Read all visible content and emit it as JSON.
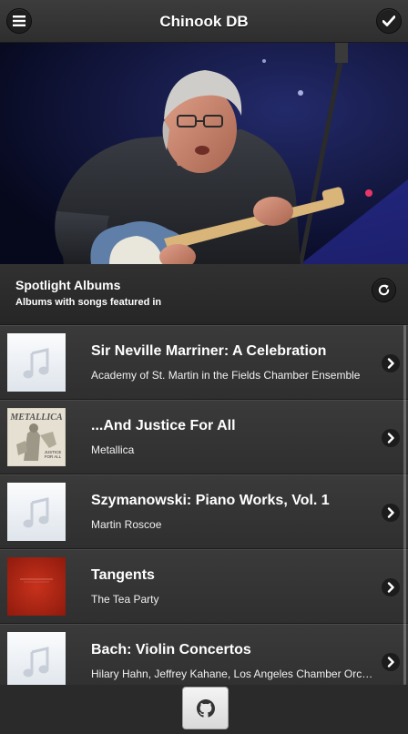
{
  "header": {
    "title": "Chinook DB",
    "menu_icon": "menu-icon",
    "check_icon": "check-icon"
  },
  "hero": {
    "description_icon": "guitarist-photo"
  },
  "spotlight": {
    "title": "Spotlight Albums",
    "subtitle": "Albums with songs featured in",
    "refresh_icon": "refresh-icon"
  },
  "albums": [
    {
      "title": "Sir Neville Marriner: A Celebration",
      "artist": "Academy of St. Martin in the Fields Chamber Ensemble",
      "thumb": "music-note"
    },
    {
      "title": "...And Justice For All",
      "artist": "Metallica",
      "thumb": "album-cover"
    },
    {
      "title": "Szymanowski: Piano Works, Vol. 1",
      "artist": "Martin Roscoe",
      "thumb": "music-note"
    },
    {
      "title": "Tangents",
      "artist": "The Tea Party",
      "thumb": "album-cover"
    },
    {
      "title": "Bach: Violin Concertos",
      "artist": "Hilary Hahn, Jeffrey Kahane, Los Angeles Chamber Orchestra",
      "thumb": "music-note"
    }
  ],
  "footer": {
    "github_icon": "github-icon"
  }
}
